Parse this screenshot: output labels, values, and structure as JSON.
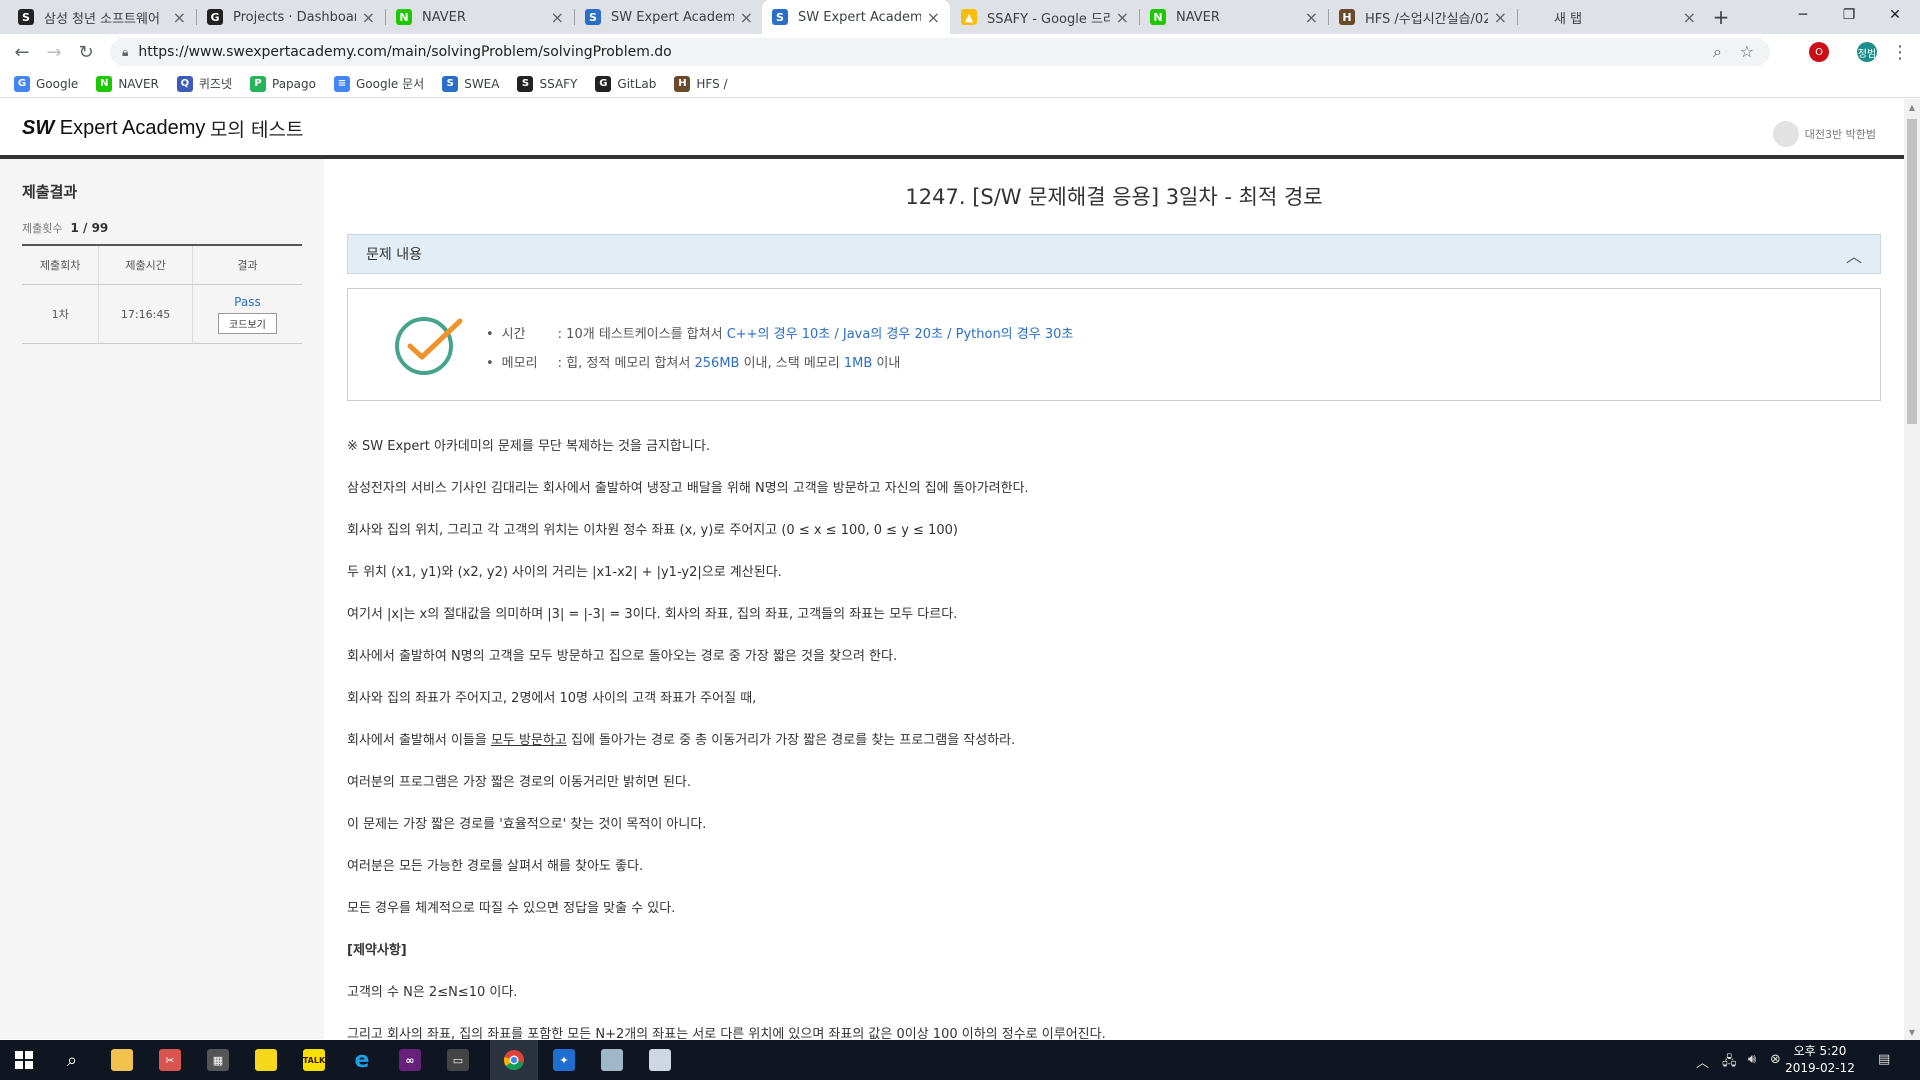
{
  "browser": {
    "tabs": [
      {
        "title": "삼성 청년 소프트웨어",
        "favicon": "ssafy-icon"
      },
      {
        "title": "Projects · Dashboard",
        "favicon": "gitlab-icon"
      },
      {
        "title": "NAVER",
        "favicon": "naver-icon"
      },
      {
        "title": "SW Expert Academy",
        "favicon": "swea-icon"
      },
      {
        "title": "SW Expert Academy",
        "favicon": "swea-icon"
      },
      {
        "title": "SSAFY - Google 드라이",
        "favicon": "google-drive-icon"
      },
      {
        "title": "NAVER",
        "favicon": "naver-icon"
      },
      {
        "title": "HFS /수업시간실습/02",
        "favicon": "hfs-icon"
      },
      {
        "title": "새 탭",
        "favicon": "newtab-icon"
      }
    ],
    "active_tab": 4,
    "url": "https://www.swexpertacademy.com/main/solvingProblem/solvingProblem.do",
    "profile_label": "정범",
    "bookmarks": [
      {
        "label": "Google",
        "icon": "google-icon",
        "color": "#4285f4",
        "glyph": "G"
      },
      {
        "label": "NAVER",
        "icon": "naver-icon",
        "color": "#1ec800",
        "glyph": "N"
      },
      {
        "label": "퀴즈넷",
        "icon": "quiznet-icon",
        "color": "#3b5cb8",
        "glyph": "Q"
      },
      {
        "label": "Papago",
        "icon": "papago-icon",
        "color": "#26b45a",
        "glyph": "P"
      },
      {
        "label": "Google 문서",
        "icon": "google-docs-icon",
        "color": "#4285f4",
        "glyph": "≡"
      },
      {
        "label": "SWEA",
        "icon": "swea-icon",
        "color": "#2a6ec8",
        "glyph": "S"
      },
      {
        "label": "SSAFY",
        "icon": "ssafy-icon",
        "color": "#222222",
        "glyph": "S"
      },
      {
        "label": "GitLab",
        "icon": "gitlab-icon",
        "color": "#222222",
        "glyph": "G"
      },
      {
        "label": "HFS /",
        "icon": "hfs-icon",
        "color": "#6b4a2b",
        "glyph": "H"
      }
    ]
  },
  "site": {
    "logo_sw": "SW",
    "logo_rest": " Expert Academy",
    "section": "모의 테스트",
    "user": "대전3반 박한범"
  },
  "submission": {
    "title": "제출결과",
    "count_label": "제출횟수",
    "count_value": "1 / 99",
    "columns": [
      "제출회차",
      "제출시간",
      "결과"
    ],
    "rows": [
      {
        "round": "1차",
        "time": "17:16:45",
        "result": "Pass",
        "code_button": "코드보기"
      }
    ]
  },
  "problem": {
    "title": "1247. [S/W 문제해결 응용] 3일차 - 최적 경로",
    "content_header": "문제 내용",
    "limits": {
      "time_label": "시간",
      "time_prefix": ": 10개 테스트케이스를 합쳐서 ",
      "time_cpp": "C++의 경우 10초",
      "time_sep1": " / ",
      "time_java": "Java의 경우 20초",
      "time_sep2": " / ",
      "time_python": "Python의 경우 30초",
      "memory_label": "메모리",
      "memory_prefix": ": 힙, 정적 메모리 합쳐서 ",
      "memory_heap": "256MB",
      "memory_mid": " 이내, 스택 메모리 ",
      "memory_stack": "1MB",
      "memory_suffix": " 이내"
    },
    "paragraphs": [
      "※ SW Expert 아카데미의 문제를 무단 복제하는 것을 금지합니다.",
      "삼성전자의 서비스 기사인 김대리는 회사에서 출발하여 냉장고 배달을 위해 N명의 고객을 방문하고 자신의 집에 돌아가려한다.",
      "회사와 집의 위치, 그리고 각 고객의 위치는 이차원 정수 좌표 (x, y)로 주어지고 (0 ≤ x ≤ 100, 0 ≤ y ≤ 100)",
      "두 위치 (x1, y1)와 (x2, y2) 사이의 거리는 |x1-x2| + |y1-y2|으로 계산된다.",
      "여기서 |x|는 x의 절대값을 의미하며 |3| = |-3| = 3이다. 회사의 좌표, 집의 좌표, 고객들의 좌표는 모두 다르다.",
      "회사에서 출발하여 N명의 고객을 모두 방문하고 집으로 돌아오는 경로 중 가장 짧은 것을 찾으려 한다.",
      "회사와 집의 좌표가 주어지고, 2명에서 10명 사이의 고객 좌표가 주어질 때,"
    ],
    "p8_pre": "회사에서 출발해서 이들을 ",
    "p8_underline": "모두 방문하고",
    "p8_post": " 집에 돌아가는 경로 중 총 이동거리가 가장 짧은 경로를 찾는 프로그램을 작성하라.",
    "paragraphs2": [
      "여러분의 프로그램은 가장 짧은 경로의 이동거리만 밝히면 된다.",
      "이 문제는 가장 짧은 경로를 '효율적으로' 찾는 것이 목적이 아니다.",
      "여러분은 모든 가능한 경로를 살펴서 해를 찾아도 좋다.",
      "모든 경우를 체계적으로 따질 수 있으면 정답을 맞출 수 있다."
    ],
    "constraints_header": "[제약사항]",
    "constraint1": "고객의 수 N은 2≤N≤10 이다.",
    "constraint2": "그리고 회사의 좌표, 집의 좌표를 포함한 모든 N+2개의 좌표는 서로 다른 위치에 있으며 좌표의 값은 0이상 100 이하의 정수로 이루어진다."
  },
  "taskbar": {
    "clock_time": "오후 5:20",
    "clock_date": "2019-02-12"
  },
  "colors": {
    "accent_blue": "#2a6ec8",
    "header_bar": "#333333",
    "content_header_bg": "#e3edf6",
    "check_teal": "#46a38c",
    "check_orange": "#f0932b"
  }
}
